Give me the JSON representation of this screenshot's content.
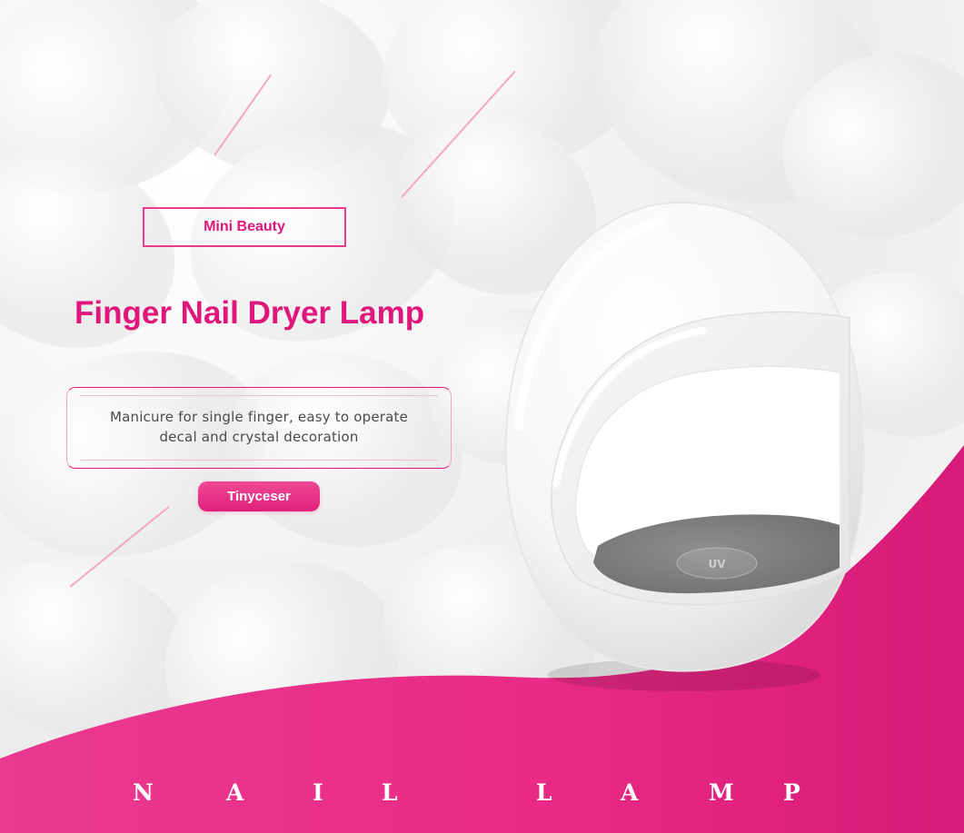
{
  "promo": {
    "badge": "Mini Beauty",
    "title": "Finger Nail Dryer Lamp",
    "description_lines": [
      "Manicure for single finger, easy to operate",
      "decal and crystal decoration"
    ],
    "brand": "Tinyceser",
    "footer_chars": [
      "N",
      "A",
      "I",
      "L",
      "L",
      "A",
      "M",
      "P"
    ]
  },
  "colors": {
    "accent": "#e4157a",
    "accent_light": "#f2a7c8",
    "text_dark": "#4b4b4b",
    "white": "#ffffff"
  },
  "icons": {
    "product": "nail-dryer-lamp-icon"
  }
}
